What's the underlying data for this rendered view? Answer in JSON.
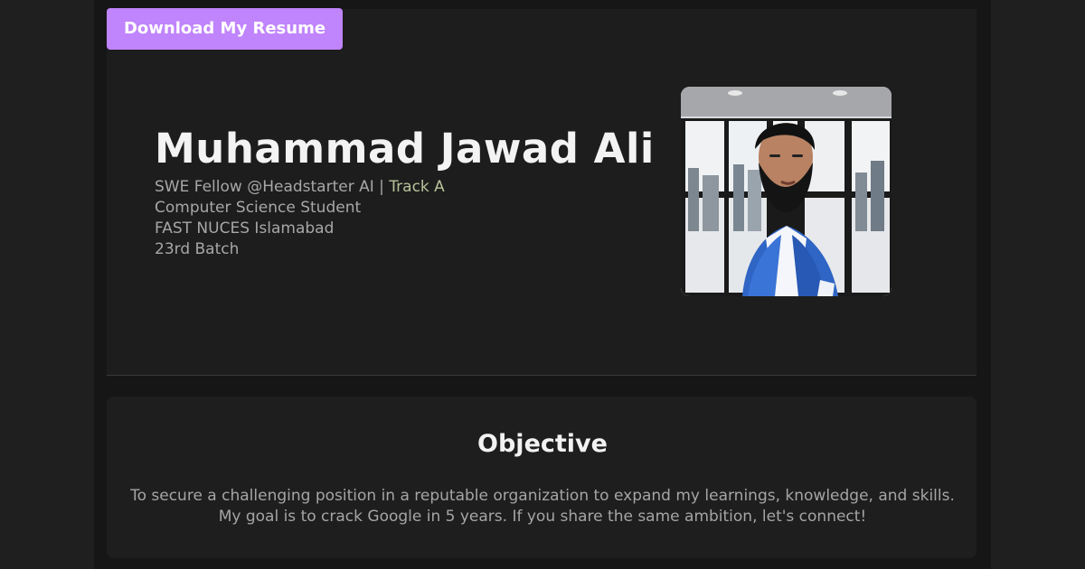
{
  "actions": {
    "download_resume": "Download My Resume"
  },
  "profile": {
    "name": "Muhammad Jawad Ali",
    "subtitle_prefix": "SWE Fellow @Headstarter AI | ",
    "track": "Track A",
    "lines": [
      "Computer Science Student",
      "FAST NUCES Islamabad",
      "23rd Batch"
    ],
    "photo_icon": "profile-photo"
  },
  "objective": {
    "title": "Objective",
    "text": "To secure a challenging position in a reputable organization to expand my learnings, knowledge, and skills. My goal is to crack Google in 5 years. If you share the same ambition, let's connect!"
  },
  "colors": {
    "page_background": "#1f1f1f",
    "panel_background": "#1d1d1d",
    "accent": "#c084fc",
    "text_primary": "#f3f3f3",
    "text_secondary": "#a7a7a7"
  }
}
